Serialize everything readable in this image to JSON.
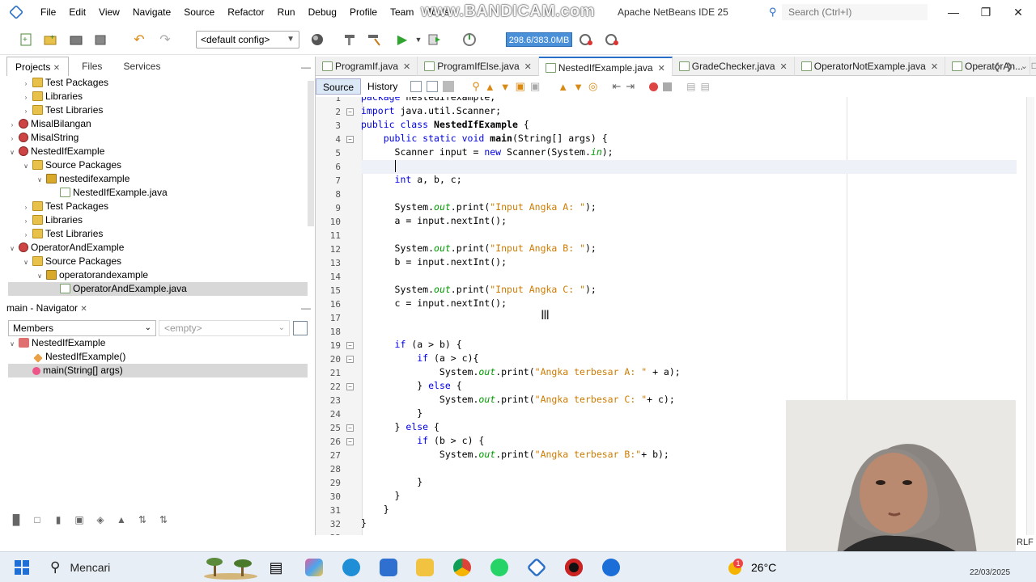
{
  "window": {
    "title": "Apache NetBeans IDE 25",
    "watermark": "www.BANDICAM.com",
    "search_placeholder": "Search (Ctrl+I)",
    "controls": {
      "minimize": "—",
      "maximize": "❐",
      "close": "✕"
    }
  },
  "menu": [
    "File",
    "Edit",
    "View",
    "Navigate",
    "Source",
    "Refactor",
    "Run",
    "Debug",
    "Profile",
    "Team",
    "Tools"
  ],
  "toolbar": {
    "config": "<default config>",
    "memory": "298.6/383.0MB"
  },
  "projects_panel": {
    "tabs": [
      "Projects",
      "Files",
      "Services"
    ],
    "tree": [
      {
        "label": "Test Packages",
        "icon": "folder",
        "indent": 1,
        "toggle": ">"
      },
      {
        "label": "Libraries",
        "icon": "folder",
        "indent": 1,
        "toggle": ">"
      },
      {
        "label": "Test Libraries",
        "icon": "folder",
        "indent": 1,
        "toggle": ">"
      },
      {
        "label": "MisalBilangan",
        "icon": "project",
        "indent": 0,
        "toggle": ">"
      },
      {
        "label": "MisalString",
        "icon": "project",
        "indent": 0,
        "toggle": ">"
      },
      {
        "label": "NestedIfExample",
        "icon": "project",
        "indent": 0,
        "toggle": "v"
      },
      {
        "label": "Source Packages",
        "icon": "folder",
        "indent": 1,
        "toggle": "v"
      },
      {
        "label": "nestedifexample",
        "icon": "package",
        "indent": 2,
        "toggle": "v"
      },
      {
        "label": "NestedIfExample.java",
        "icon": "java",
        "indent": 3,
        "toggle": ""
      },
      {
        "label": "Test Packages",
        "icon": "folder",
        "indent": 1,
        "toggle": ">"
      },
      {
        "label": "Libraries",
        "icon": "folder",
        "indent": 1,
        "toggle": ">"
      },
      {
        "label": "Test Libraries",
        "icon": "folder",
        "indent": 1,
        "toggle": ">"
      },
      {
        "label": "OperatorAndExample",
        "icon": "project",
        "indent": 0,
        "toggle": "v"
      },
      {
        "label": "Source Packages",
        "icon": "folder",
        "indent": 1,
        "toggle": "v"
      },
      {
        "label": "operatorandexample",
        "icon": "package",
        "indent": 2,
        "toggle": "v"
      },
      {
        "label": "OperatorAndExample.java",
        "icon": "java",
        "indent": 3,
        "toggle": "",
        "selected": true
      }
    ]
  },
  "navigator": {
    "title": "main - Navigator",
    "members": "Members",
    "filter": "<empty>",
    "tree": [
      {
        "label": "NestedIfExample",
        "icon": "class",
        "indent": 0,
        "toggle": "v"
      },
      {
        "label": "NestedIfExample()",
        "icon": "ctor",
        "indent": 1,
        "toggle": ""
      },
      {
        "label": "main(String[] args)",
        "icon": "method",
        "indent": 1,
        "toggle": "",
        "selected": true
      }
    ]
  },
  "editor": {
    "tabs": [
      {
        "label": "ProgramIf.java",
        "active": false
      },
      {
        "label": "ProgramIfElse.java",
        "active": false
      },
      {
        "label": "NestedIfExample.java",
        "active": true
      },
      {
        "label": "GradeChecker.java",
        "active": false
      },
      {
        "label": "OperatorNotExample.java",
        "active": false
      },
      {
        "label": "OperatorAn...",
        "active": false
      }
    ],
    "modes": [
      "Source",
      "History"
    ],
    "status_right": "RLF"
  },
  "code_lines": [
    {
      "n": "1",
      "html": "<span class=\"kw\">package</span> nestedifexample;"
    },
    {
      "n": "2",
      "html": "<span class=\"kw\">import</span> java.util.Scanner;",
      "fold": "−"
    },
    {
      "n": "3",
      "html": "<span class=\"kw\">public class</span> <span class=\"bold\">NestedIfExample</span> {"
    },
    {
      "n": "4",
      "html": "    <span class=\"kw\">public static void</span> <span class=\"bold\">main</span>(String[] args) {",
      "fold": "−"
    },
    {
      "n": "5",
      "html": "      Scanner input = <span class=\"kw\">new</span> Scanner(System.<span class=\"fld\">in</span>);"
    },
    {
      "n": "6",
      "html": "      ",
      "current": true
    },
    {
      "n": "7",
      "html": "      <span class=\"kw\">int</span> a, b, c;"
    },
    {
      "n": "8",
      "html": ""
    },
    {
      "n": "9",
      "html": "      System.<span class=\"fld\">out</span>.print(<span class=\"str\">\"Input Angka A: \"</span>);"
    },
    {
      "n": "10",
      "html": "      a = input.nextInt();"
    },
    {
      "n": "11",
      "html": ""
    },
    {
      "n": "12",
      "html": "      System.<span class=\"fld\">out</span>.print(<span class=\"str\">\"Input Angka B: \"</span>);"
    },
    {
      "n": "13",
      "html": "      b = input.nextInt();"
    },
    {
      "n": "14",
      "html": ""
    },
    {
      "n": "15",
      "html": "      System.<span class=\"fld\">out</span>.print(<span class=\"str\">\"Input Angka C: \"</span>);"
    },
    {
      "n": "16",
      "html": "      c = input.nextInt();"
    },
    {
      "n": "17",
      "html": ""
    },
    {
      "n": "18",
      "html": ""
    },
    {
      "n": "19",
      "html": "      <span class=\"kw\">if</span> (a &gt; b) {",
      "fold": "−"
    },
    {
      "n": "20",
      "html": "          <span class=\"kw\">if</span> (a &gt; c){",
      "fold": "−"
    },
    {
      "n": "21",
      "html": "              System.<span class=\"fld\">out</span>.print(<span class=\"str\">\"Angka terbesar A: \"</span> + a);"
    },
    {
      "n": "22",
      "html": "          } <span class=\"kw\">else</span> {",
      "fold": "−"
    },
    {
      "n": "23",
      "html": "              System.<span class=\"fld\">out</span>.print(<span class=\"str\">\"Angka terbesar C: \"</span>+ c);"
    },
    {
      "n": "24",
      "html": "          }"
    },
    {
      "n": "25",
      "html": "      } <span class=\"kw\">else</span> {",
      "fold": "−"
    },
    {
      "n": "26",
      "html": "          <span class=\"kw\">if</span> (b &gt; c) {",
      "fold": "−"
    },
    {
      "n": "27",
      "html": "              System.<span class=\"fld\">out</span>.print(<span class=\"str\">\"Angka terbesar B:\"</span>+ b);"
    },
    {
      "n": "28",
      "html": ""
    },
    {
      "n": "29",
      "html": "          }"
    },
    {
      "n": "30",
      "html": "      }"
    },
    {
      "n": "31",
      "html": "    }"
    },
    {
      "n": "32",
      "html": "}"
    },
    {
      "n": "33",
      "html": ""
    }
  ],
  "taskbar": {
    "search_label": "Mencari",
    "temperature": "26°C",
    "weather_badge": "1",
    "date": "22/03/2025"
  },
  "colors": {
    "accent": "#2a6fc7",
    "keyword": "#0000e6",
    "string": "#ce7b00",
    "field": "#009900"
  }
}
